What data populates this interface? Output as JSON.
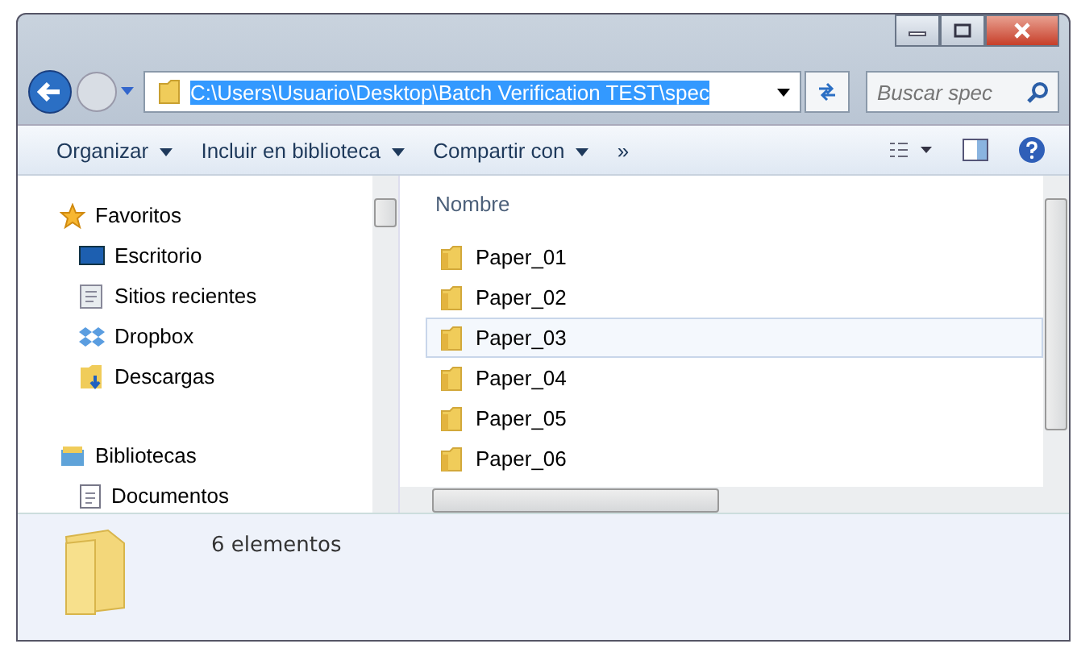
{
  "address": {
    "value": "C:\\Users\\Usuario\\Desktop\\Batch Verification TEST\\spec",
    "selected": true
  },
  "search": {
    "placeholder": "Buscar spec"
  },
  "toolbar": {
    "items": [
      "Organizar",
      "Incluir en biblioteca",
      "Compartir con"
    ],
    "more": "»"
  },
  "sidebar": {
    "groups": [
      {
        "label": "Favoritos",
        "kind": "star",
        "children": [
          {
            "label": "Escritorio",
            "kind": "desktop"
          },
          {
            "label": "Sitios recientes",
            "kind": "recent"
          },
          {
            "label": "Dropbox",
            "kind": "dropbox"
          },
          {
            "label": "Descargas",
            "kind": "downloads"
          }
        ]
      },
      {
        "label": "Bibliotecas",
        "kind": "library",
        "children": [
          {
            "label": "Documentos",
            "kind": "documents"
          }
        ]
      }
    ]
  },
  "list": {
    "column": "Nombre",
    "rows": [
      {
        "name": "Paper_01",
        "selected": false
      },
      {
        "name": "Paper_02",
        "selected": false
      },
      {
        "name": "Paper_03",
        "selected": true
      },
      {
        "name": "Paper_04",
        "selected": false
      },
      {
        "name": "Paper_05",
        "selected": false
      },
      {
        "name": "Paper_06",
        "selected": false
      }
    ]
  },
  "status_bar": {
    "text": "6 elementos"
  }
}
